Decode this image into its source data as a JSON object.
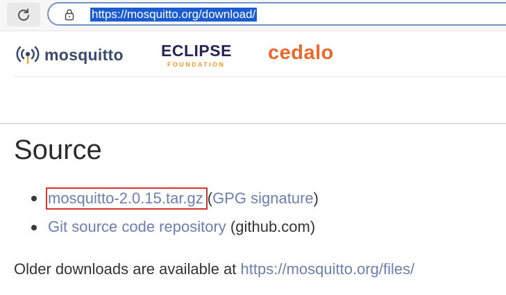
{
  "browser": {
    "url": "https://mosquitto.org/download/",
    "reload_icon": "reload-icon",
    "lock_icon": "lock-icon"
  },
  "logos": {
    "mosquitto": "mosquitto",
    "eclipse_main": "ECLIPSE",
    "eclipse_sub": "FOUNDATION",
    "cedalo": "cedalo"
  },
  "colors": {
    "link": "#6b7fae",
    "highlight_border": "#d9322f",
    "url_selection": "#1a5bd1",
    "eclipse_orange": "#f29a1f",
    "cedalo_orange": "#e9692c"
  },
  "content": {
    "title": "Source",
    "items": [
      {
        "link": "mosquitto-2.0.15.tar.gz",
        "open_paren": "(",
        "sig_link": "GPG signature",
        "close_paren": ")"
      },
      {
        "link": "Git source code repository",
        "suffix": "(github.com)"
      }
    ],
    "older_prefix": "Older downloads are available at",
    "older_link": "https://mosquitto.org/files/"
  }
}
